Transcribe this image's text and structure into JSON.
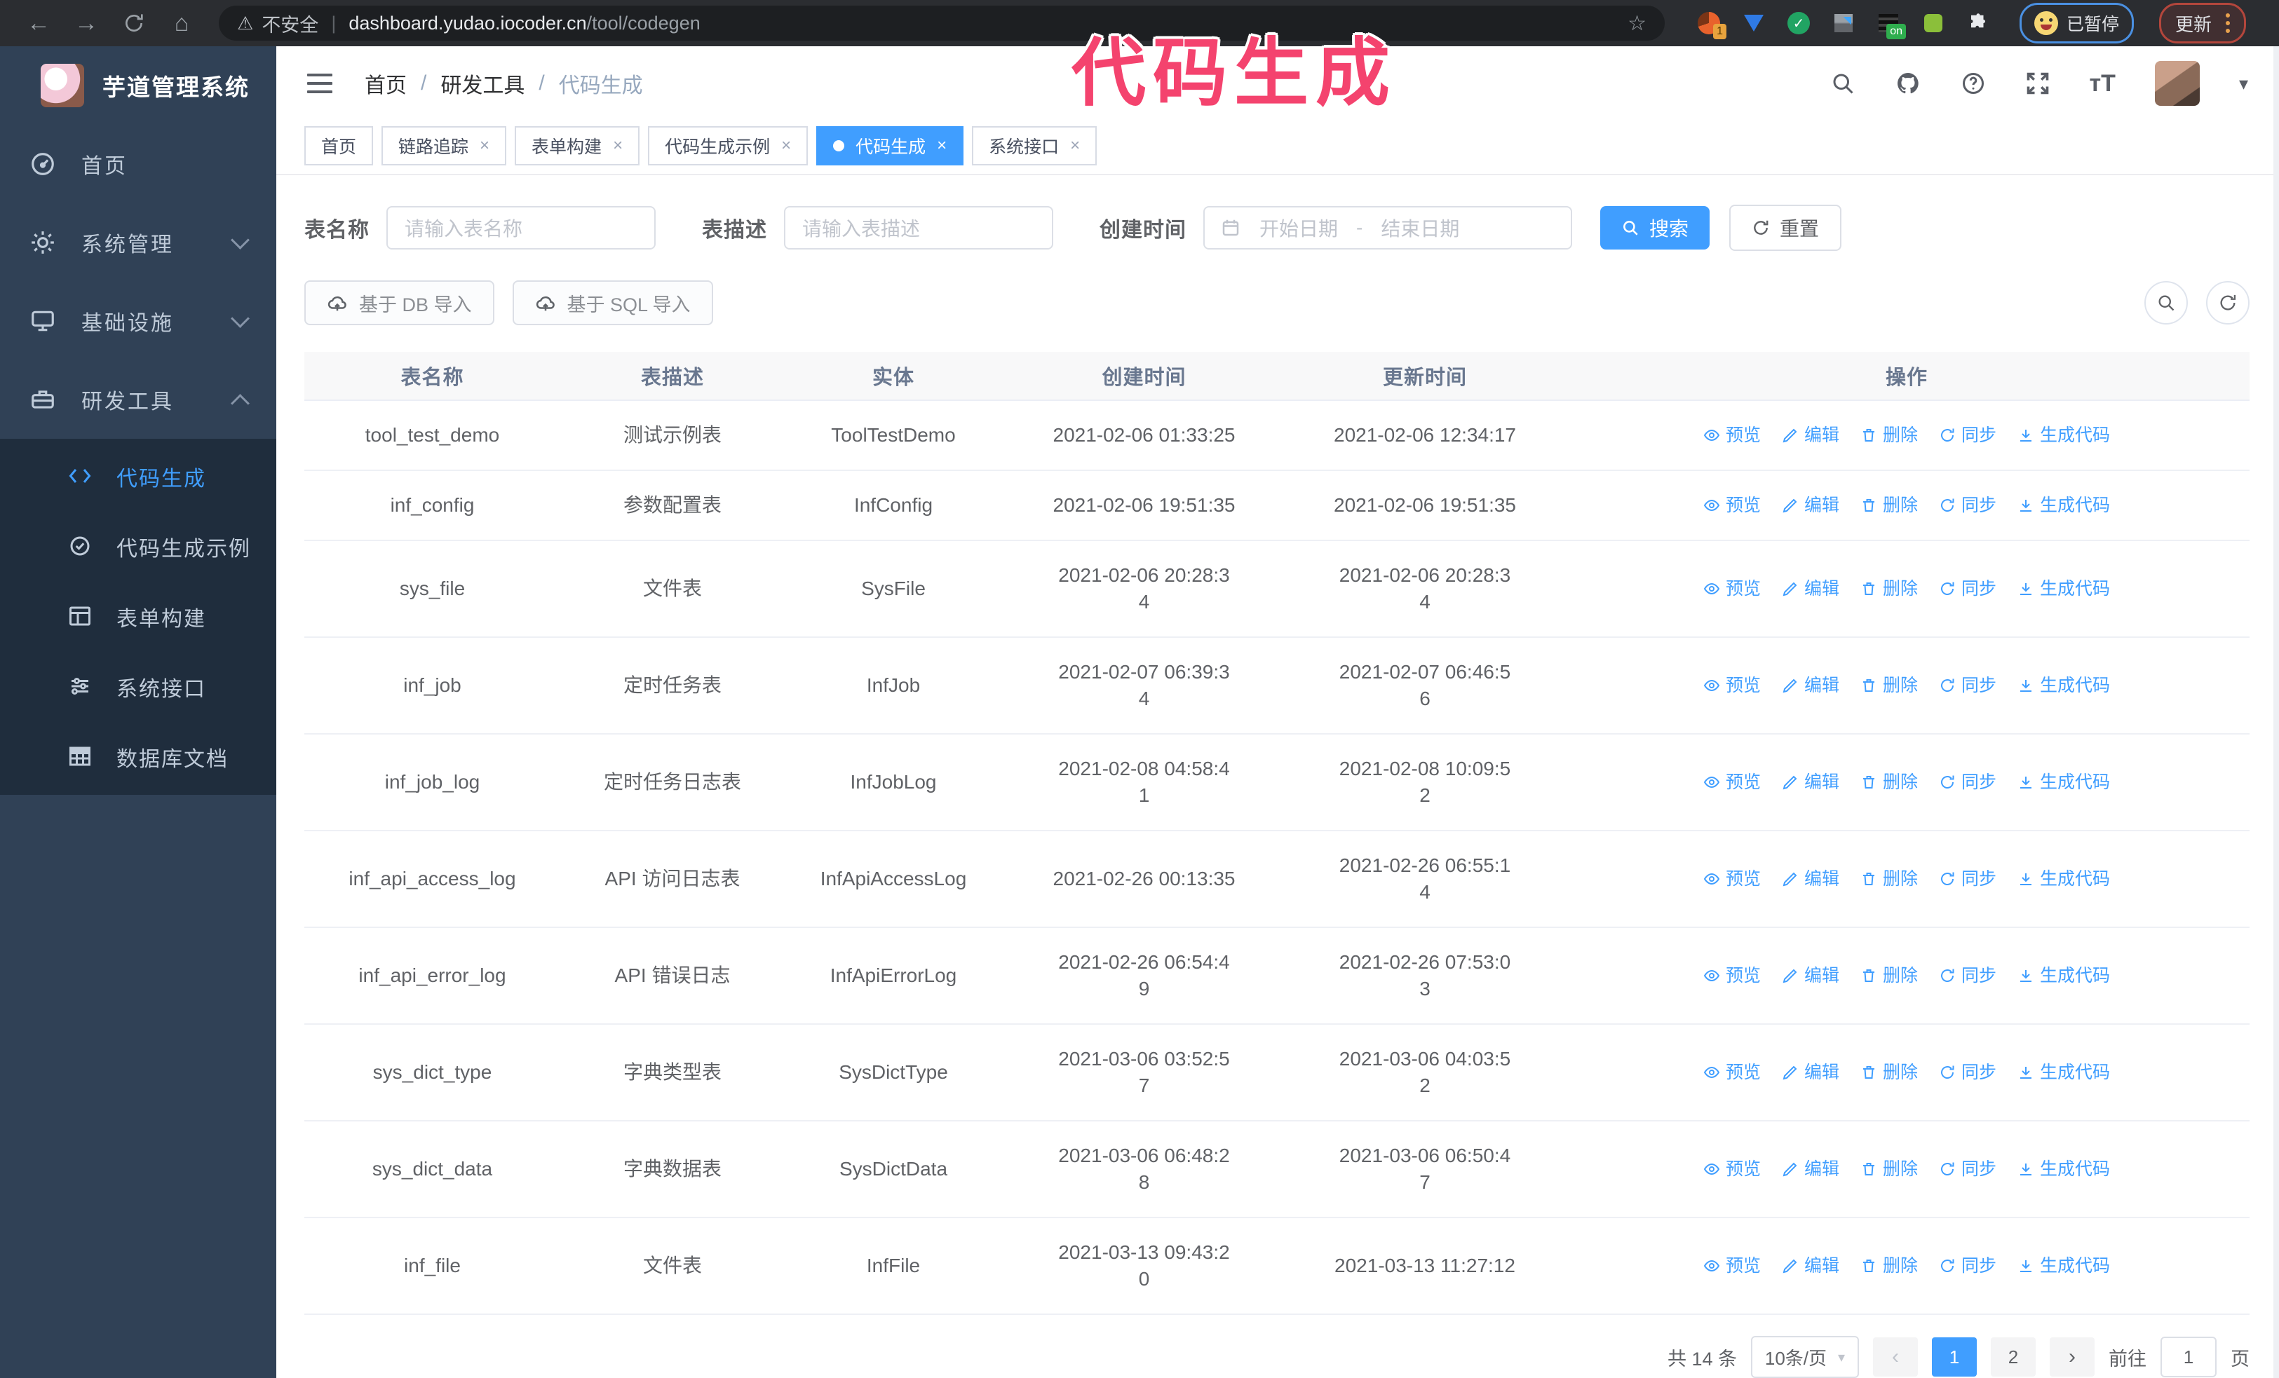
{
  "browser": {
    "security_label": "不安全",
    "url_host": "dashboard.yudao.iocoder.cn",
    "url_path": "/tool/codegen",
    "extension_count_badge": "1",
    "extension_on_badge": "on",
    "paused_chip_label": "已暂停",
    "update_button_label": "更新"
  },
  "annotation": {
    "text": "代码生成",
    "color": "#f4436e"
  },
  "sidebar": {
    "title": "芋道管理系统",
    "items": [
      {
        "label": "首页",
        "icon": "dashboard-icon"
      },
      {
        "label": "系统管理",
        "icon": "gear-icon",
        "chevron": "down"
      },
      {
        "label": "基础设施",
        "icon": "infrastructure-icon",
        "chevron": "down"
      },
      {
        "label": "研发工具",
        "icon": "toolbox-icon",
        "chevron": "up"
      }
    ],
    "subitems": [
      {
        "label": "代码生成",
        "icon": "code-icon",
        "active": true
      },
      {
        "label": "代码生成示例",
        "icon": "badge-check-icon"
      },
      {
        "label": "表单构建",
        "icon": "form-icon"
      },
      {
        "label": "系统接口",
        "icon": "sliders-icon"
      },
      {
        "label": "数据库文档",
        "icon": "database-doc-icon"
      }
    ]
  },
  "header": {
    "breadcrumb": [
      "首页",
      "研发工具",
      "代码生成"
    ],
    "separator": "/"
  },
  "tabs": [
    {
      "label": "首页"
    },
    {
      "label": "链路追踪"
    },
    {
      "label": "表单构建"
    },
    {
      "label": "代码生成示例"
    },
    {
      "label": "代码生成"
    },
    {
      "label": "系统接口"
    }
  ],
  "filters": {
    "table_name_label": "表名称",
    "table_name_placeholder": "请输入表名称",
    "table_desc_label": "表描述",
    "table_desc_placeholder": "请输入表描述",
    "create_time_label": "创建时间",
    "date_start_placeholder": "开始日期",
    "date_separator": "-",
    "date_end_placeholder": "结束日期",
    "search_label": "搜索",
    "reset_label": "重置"
  },
  "toolbar": {
    "import_db_label": "基于 DB 导入",
    "import_sql_label": "基于 SQL 导入"
  },
  "table": {
    "columns": [
      "表名称",
      "表描述",
      "实体",
      "创建时间",
      "更新时间",
      "操作"
    ],
    "actions": [
      "预览",
      "编辑",
      "删除",
      "同步",
      "生成代码"
    ],
    "rows": [
      {
        "name": "tool_test_demo",
        "desc": "测试示例表",
        "entity": "ToolTestDemo",
        "created": "2021-02-06 01:33:25",
        "updated": "2021-02-06 12:34:17"
      },
      {
        "name": "inf_config",
        "desc": "参数配置表",
        "entity": "InfConfig",
        "created": "2021-02-06 19:51:35",
        "updated": "2021-02-06 19:51:35"
      },
      {
        "name": "sys_file",
        "desc": "文件表",
        "entity": "SysFile",
        "created": "2021-02-06 20:28:3\n4",
        "updated": "2021-02-06 20:28:3\n4"
      },
      {
        "name": "inf_job",
        "desc": "定时任务表",
        "entity": "InfJob",
        "created": "2021-02-07 06:39:3\n4",
        "updated": "2021-02-07 06:46:5\n6"
      },
      {
        "name": "inf_job_log",
        "desc": "定时任务日志表",
        "entity": "InfJobLog",
        "created": "2021-02-08 04:58:4\n1",
        "updated": "2021-02-08 10:09:5\n2"
      },
      {
        "name": "inf_api_access_log",
        "desc": "API 访问日志表",
        "entity": "InfApiAccessLog",
        "created": "2021-02-26 00:13:35",
        "updated": "2021-02-26 06:55:1\n4"
      },
      {
        "name": "inf_api_error_log",
        "desc": "API 错误日志",
        "entity": "InfApiErrorLog",
        "created": "2021-02-26 06:54:4\n9",
        "updated": "2021-02-26 07:53:0\n3"
      },
      {
        "name": "sys_dict_type",
        "desc": "字典类型表",
        "entity": "SysDictType",
        "created": "2021-03-06 03:52:5\n7",
        "updated": "2021-03-06 04:03:5\n2"
      },
      {
        "name": "sys_dict_data",
        "desc": "字典数据表",
        "entity": "SysDictData",
        "created": "2021-03-06 06:48:2\n8",
        "updated": "2021-03-06 06:50:4\n7"
      },
      {
        "name": "inf_file",
        "desc": "文件表",
        "entity": "InfFile",
        "created": "2021-03-13 09:43:2\n0",
        "updated": "2021-03-13 11:27:12"
      }
    ]
  },
  "pagination": {
    "total_label": "共 14 条",
    "page_size": "10条/页",
    "pages": [
      "1",
      "2"
    ],
    "active_page": "1",
    "goto_label": "前往",
    "goto_value": "1",
    "page_unit": "页"
  },
  "colors": {
    "accent": "#409eff",
    "sidebar_bg": "#304156",
    "submenu_bg": "#1f2d3d",
    "annotation_pink": "#f4436e"
  }
}
